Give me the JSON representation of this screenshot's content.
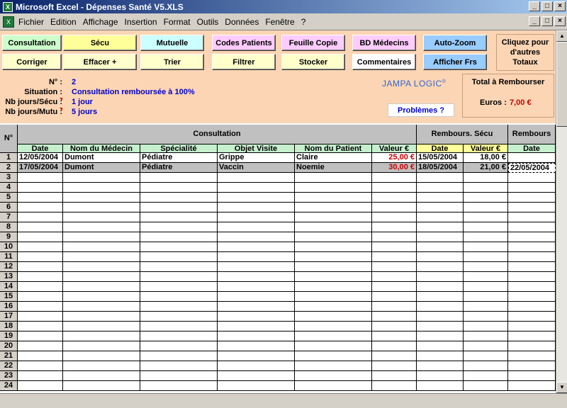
{
  "window": {
    "title": "Microsoft Excel - Dépenses Santé V5.XLS"
  },
  "menu": [
    "Fichier",
    "Edition",
    "Affichage",
    "Insertion",
    "Format",
    "Outils",
    "Données",
    "Fenêtre",
    "?"
  ],
  "buttons_row1": [
    {
      "label": "Consultation",
      "color": "#ccffcc"
    },
    {
      "label": "Sécu",
      "color": "#ffff99"
    },
    {
      "label": "Mutuelle",
      "color": "#ccffff"
    },
    {
      "label": "Codes Patients",
      "color": "#ffccff"
    },
    {
      "label": "Feuille Copie",
      "color": "#ffccff"
    },
    {
      "label": "BD Médecins",
      "color": "#ffccff"
    },
    {
      "label": "Auto-Zoom",
      "color": "#99ccff"
    }
  ],
  "buttons_row2": [
    {
      "label": "Corriger",
      "color": "#ffffcc"
    },
    {
      "label": "Effacer +",
      "color": "#ffffcc"
    },
    {
      "label": "Trier",
      "color": "#ffffcc"
    },
    {
      "label": "Filtrer",
      "color": "#ffffcc"
    },
    {
      "label": "Stocker",
      "color": "#ffffcc"
    },
    {
      "label": "Commentaires",
      "color": "#ffffff"
    },
    {
      "label": "Afficher Frs",
      "color": "#99ccff"
    }
  ],
  "click_totals": "Cliquez pour d'autres Totaux",
  "info": [
    {
      "label": "N° :",
      "value": "2"
    },
    {
      "label": "Situation :",
      "value": "Consultation remboursée à 100%"
    },
    {
      "label": "Nb jours/Sécu :",
      "value": "1 jour"
    },
    {
      "label": "Nb jours/Mutu :",
      "value": "5 jours"
    }
  ],
  "brand": "JAMPA LOGIC",
  "problems_label": "Problèmes ?",
  "total": {
    "title": "Total à Rembourser",
    "euros_label": "Euros :",
    "euros_value": "7,00 €"
  },
  "table": {
    "num_header": "N°",
    "group_consultation": "Consultation",
    "group_secu": "Rembours. Sécu",
    "group_mutu": "Rembours",
    "columns": [
      "Date",
      "Nom du Médecin",
      "Spécialité",
      "Objet Visite",
      "Nom du Patient",
      "Valeur €",
      "Date",
      "Valeur €",
      "Date"
    ],
    "rows": [
      {
        "n": "1",
        "date": "12/05/2004",
        "medecin": "Dumont",
        "specialite": "Pédiatre",
        "objet": "Grippe",
        "patient": "Claire",
        "valeur": "25,00 €",
        "secu_date": "15/05/2004",
        "secu_valeur": "18,00 €",
        "mutu_date": ""
      },
      {
        "n": "2",
        "date": "17/05/2004",
        "medecin": "Dumont",
        "specialite": "Pédiatre",
        "objet": "Vaccin",
        "patient": "Noemie",
        "valeur": "30,00 €",
        "secu_date": "18/05/2004",
        "secu_valeur": "21,00 €",
        "mutu_date": "22/05/2004"
      }
    ],
    "empty_rows": [
      "3",
      "4",
      "5",
      "6",
      "7",
      "8",
      "9",
      "10",
      "11",
      "12",
      "13",
      "14",
      "15",
      "16",
      "17",
      "18",
      "19",
      "20",
      "21",
      "22",
      "23",
      "24"
    ]
  }
}
